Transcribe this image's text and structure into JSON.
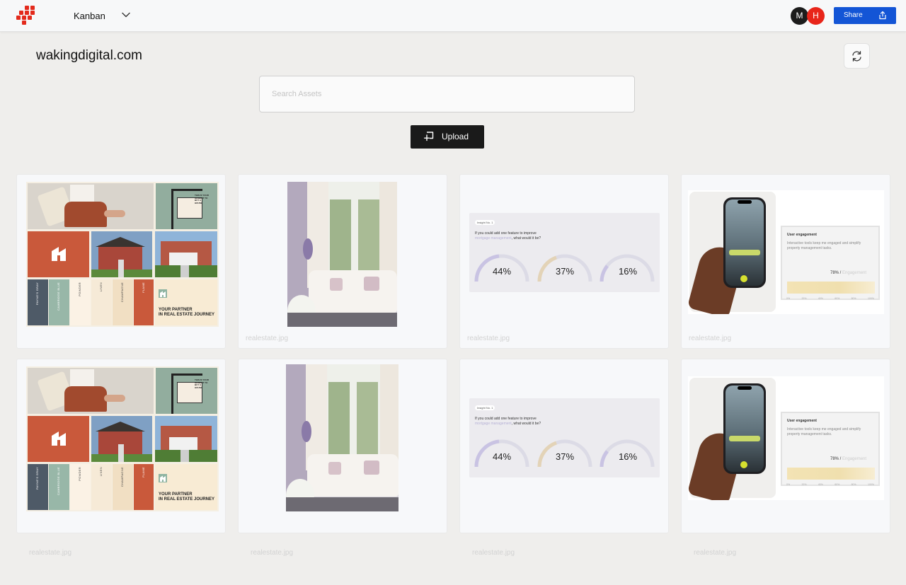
{
  "app": {
    "board_name": "Kanban",
    "logo_icon": "grid-logo-icon",
    "brand_color": "#e32a1c",
    "accent_color": "#1355d6"
  },
  "users": [
    {
      "initial": "M",
      "color": "#1c1c1c"
    },
    {
      "initial": "H",
      "color": "#e8251a"
    }
  ],
  "header": {
    "share_label": "Share",
    "site_title": "wakingdigital.com"
  },
  "search": {
    "placeholder": "Search Assets"
  },
  "upload": {
    "label": "Upload"
  },
  "assets": [
    {
      "kind": "collage",
      "filename": "realestate.jpg"
    },
    {
      "kind": "room",
      "filename": "realestate.jpg"
    },
    {
      "kind": "survey",
      "filename": "realestate.jpg"
    },
    {
      "kind": "phone",
      "filename": "realestate.jpg"
    },
    {
      "kind": "collage",
      "filename": "realestate.jpg"
    },
    {
      "kind": "room",
      "filename": "realestate.jpg"
    },
    {
      "kind": "survey",
      "filename": "realestate.jpg"
    },
    {
      "kind": "phone",
      "filename": "realestate.jpg"
    }
  ],
  "collage": {
    "swatches": [
      "PAYNE'S GRAY",
      "CAMBRIDGE BLUE",
      "POWDER",
      "LINEN",
      "CHAMPAGNE",
      "FLAME"
    ],
    "tagline_line1": "YOUR PARTNER",
    "tagline_line2": "IN REAL ESTATE JOURNEY",
    "sign_text": "THIS IS YOUR MOMENT TO BUY A HOUSE"
  },
  "survey": {
    "badge": "Insight No. 1",
    "question_line1": "If you could add one feature to improve",
    "question_highlight": "mortgage management",
    "question_line2": ", what would it be?",
    "gauges": [
      "44%",
      "37%",
      "16%"
    ]
  },
  "phone": {
    "panel_title": "User engagement",
    "panel_text": "Interactive tools keep me engaged and simplify property management tasks.",
    "stat_value": "78% /",
    "stat_label": "Engagement",
    "scale": [
      "0%",
      "20%",
      "40%",
      "60%",
      "80%",
      "100%"
    ]
  }
}
